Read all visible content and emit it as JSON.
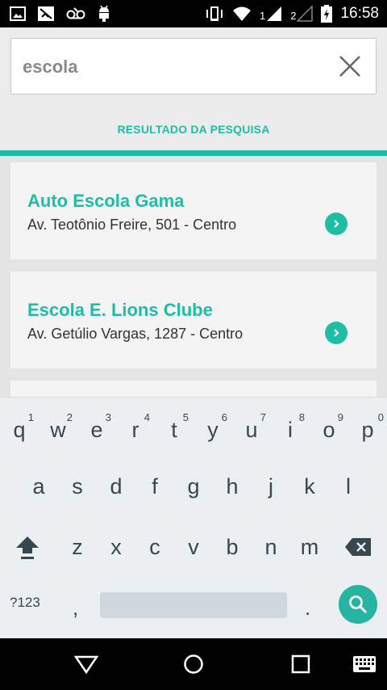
{
  "status_bar": {
    "time": "16:58",
    "sim1": "1",
    "sim2": "2",
    "left_icons": [
      "image-notification-icon",
      "blocked-notification-icon",
      "voicemail-icon",
      "android-debug-icon"
    ],
    "right_icons": [
      "vibrate-icon",
      "wifi-icon",
      "signal-sim1-icon",
      "signal-sim2-icon",
      "battery-charging-icon"
    ]
  },
  "search": {
    "value": "escola",
    "clear_icon": "close-icon"
  },
  "results": {
    "heading": "RESULTADO DA PESQUISA",
    "items": [
      {
        "title": "Auto Escola Gama",
        "address": "Av. Teotônio Freire, 501 - Centro"
      },
      {
        "title": "Escola E. Lions Clube",
        "address": "Av. Getúlio Vargas, 1287 - Centro"
      }
    ]
  },
  "keyboard": {
    "row1": [
      "q",
      "w",
      "e",
      "r",
      "t",
      "y",
      "u",
      "i",
      "o",
      "p"
    ],
    "row1_hints": [
      "1",
      "2",
      "3",
      "4",
      "5",
      "6",
      "7",
      "8",
      "9",
      "0"
    ],
    "row2": [
      "a",
      "s",
      "d",
      "f",
      "g",
      "h",
      "j",
      "k",
      "l"
    ],
    "row3": [
      "z",
      "x",
      "c",
      "v",
      "b",
      "n",
      "m"
    ],
    "symbols_label": "?123",
    "comma": ",",
    "period": "."
  },
  "colors": {
    "accent": "#1ebea5",
    "status_bar": "#000000",
    "keyboard_bg": "#eceff1"
  }
}
